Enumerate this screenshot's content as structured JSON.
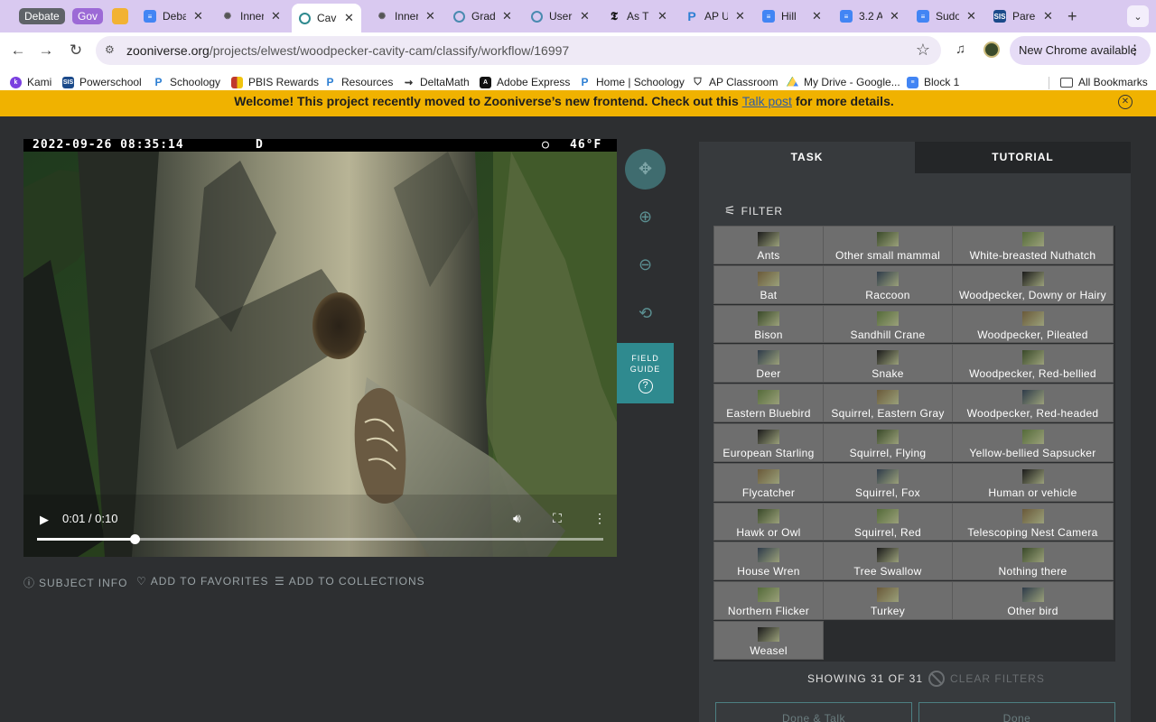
{
  "browser": {
    "groups": [
      {
        "label": "Debate",
        "color": "#5f6368"
      },
      {
        "label": "Gov",
        "color": "#9c6ad6"
      }
    ],
    "tabs": [
      {
        "title": "Debate",
        "icon": "docs-icon",
        "active": false
      },
      {
        "title": "Inner",
        "icon": "zooniverse-icon",
        "active": false
      },
      {
        "title": "Cavity",
        "icon": "zooniverse-icon",
        "active": true
      },
      {
        "title": "Inner",
        "icon": "zooniverse-icon",
        "active": false
      },
      {
        "title": "Grad",
        "icon": "compass-icon",
        "active": false
      },
      {
        "title": "User",
        "icon": "compass-icon",
        "active": false
      },
      {
        "title": "As T",
        "icon": "nyt-icon",
        "active": false
      },
      {
        "title": "AP U",
        "icon": "schoology-icon",
        "active": false
      },
      {
        "title": "Hill",
        "icon": "docs-icon",
        "active": false
      },
      {
        "title": "3.2 A",
        "icon": "docs-icon",
        "active": false
      },
      {
        "title": "Sudo",
        "icon": "docs-icon",
        "active": false
      },
      {
        "title": "Pare",
        "icon": "sis-icon",
        "active": false
      }
    ],
    "url_domain": "zooniverse.org",
    "url_path": "/projects/elwest/woodpecker-cavity-cam/classify/workflow/16997",
    "update_label": "New Chrome available",
    "bookmarks": [
      {
        "label": "Kami",
        "color": "#7a3fe0"
      },
      {
        "label": "Powerschool",
        "color": "#1b4a8a"
      },
      {
        "label": "Schoology",
        "color": "#2d7fd3"
      },
      {
        "label": "PBIS Rewards",
        "color": "#c0392b"
      },
      {
        "label": "Resources",
        "color": "#2d7fd3"
      },
      {
        "label": "DeltaMath",
        "color": "#333333"
      },
      {
        "label": "Adobe Express",
        "color": "#111111"
      },
      {
        "label": "Home | Schoology",
        "color": "#2d7fd3"
      },
      {
        "label": "AP Classroom",
        "color": "#333333"
      },
      {
        "label": "My Drive - Google...",
        "color": "#1fa463"
      },
      {
        "label": "Block 1",
        "color": "#4285f4"
      }
    ],
    "all_bookmarks": "All Bookmarks"
  },
  "banner": {
    "before": "Welcome! This project recently moved to Zooniverse’s new frontend. Check out this ",
    "link": "Talk post",
    "after": " for more details."
  },
  "viewer": {
    "stamp_date": "2022-09-26 08:35:14",
    "stamp_letter": "D",
    "stamp_moon": "○",
    "stamp_temp": "46°F",
    "time": "0:01 / 0:10",
    "progress": 0.173,
    "field_guide": "FIELD GUIDE",
    "tools": [
      "move-icon",
      "zoom-in-icon",
      "zoom-out-icon",
      "reset-icon"
    ]
  },
  "subject_links": {
    "info": "SUBJECT INFO",
    "favorites": "ADD TO FAVORITES",
    "collections": "ADD TO COLLECTIONS"
  },
  "task_panel": {
    "tab_task": "TASK",
    "tab_tutorial": "TUTORIAL",
    "filter_label": "FILTER",
    "choices": [
      "Ants",
      "Other small mammal",
      "White-breasted Nuthatch",
      "Bat",
      "Raccoon",
      "Woodpecker, Downy or Hairy",
      "Bison",
      "Sandhill Crane",
      "Woodpecker, Pileated",
      "Deer",
      "Snake",
      "Woodpecker, Red-bellied",
      "Eastern Bluebird",
      "Squirrel, Eastern Gray",
      "Woodpecker, Red-headed",
      "European Starling",
      "Squirrel, Flying",
      "Yellow-bellied Sapsucker",
      "Flycatcher",
      "Squirrel, Fox",
      "Human or vehicle",
      "Hawk or Owl",
      "Squirrel, Red",
      "Telescoping Nest Camera",
      "House Wren",
      "Tree Swallow",
      "Nothing there",
      "Northern Flicker",
      "Turkey",
      "Other bird",
      "Weasel"
    ],
    "showing": "SHOWING 31 OF 31",
    "clear_filters": "CLEAR FILTERS",
    "done_talk": "Done & Talk",
    "done": "Done"
  }
}
